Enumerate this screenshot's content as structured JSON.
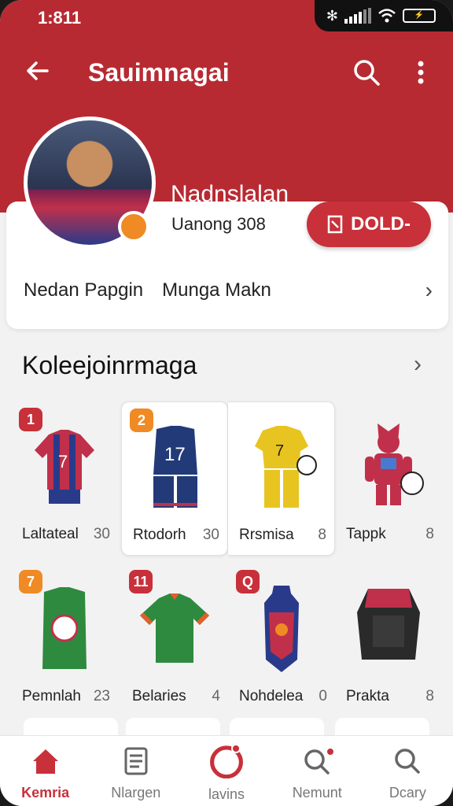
{
  "status": {
    "time": "1:811",
    "battery": "⚡"
  },
  "header": {
    "title": "Sauimnagai",
    "name": "Nadnslalan"
  },
  "profile": {
    "ranking": "Uanong 308",
    "gold_button": "DOLD-",
    "row_left": "Nedan Papgin",
    "row_right": "Munga Makn"
  },
  "collection": {
    "title": "Koleejoinrmaga",
    "items": [
      {
        "badge": "1",
        "badge_color": "#c8303a",
        "name": "Laltateal",
        "count": "30",
        "icon": "jersey-red-blue-icon"
      },
      {
        "badge": "2",
        "badge_color": "#f08a24",
        "name": "Rtodorh",
        "count": "30",
        "icon": "kit-navy-icon"
      },
      {
        "badge": "",
        "badge_color": "",
        "name": "Rrsmisa",
        "count": "8",
        "icon": "kit-yellow-icon"
      },
      {
        "badge": "",
        "badge_color": "",
        "name": "Tappk",
        "count": "8",
        "icon": "robot-figure-icon"
      },
      {
        "badge": "7",
        "badge_color": "#f08a24",
        "name": "Pemnlah",
        "count": "23",
        "icon": "jersey-green-icon"
      },
      {
        "badge": "11",
        "badge_color": "#c8303a",
        "name": "Belaries",
        "count": "4",
        "icon": "jersey-green-orange-icon"
      },
      {
        "badge": "Q",
        "badge_color": "#c8303a",
        "name": "Nohdelea",
        "count": "0",
        "icon": "shield-armor-icon"
      },
      {
        "badge": "",
        "badge_color": "",
        "name": "Prakta",
        "count": "8",
        "icon": "chest-armor-icon"
      }
    ]
  },
  "nav": [
    {
      "label": "Kemria",
      "icon": "home-icon"
    },
    {
      "label": "Nlargen",
      "icon": "document-icon"
    },
    {
      "label": "lavins",
      "icon": "circle-icon"
    },
    {
      "label": "Nemunt",
      "icon": "search-notify-icon"
    },
    {
      "label": "Dcary",
      "icon": "search-icon"
    }
  ],
  "colors": {
    "primary": "#b82a32",
    "accent": "#f08a24"
  }
}
